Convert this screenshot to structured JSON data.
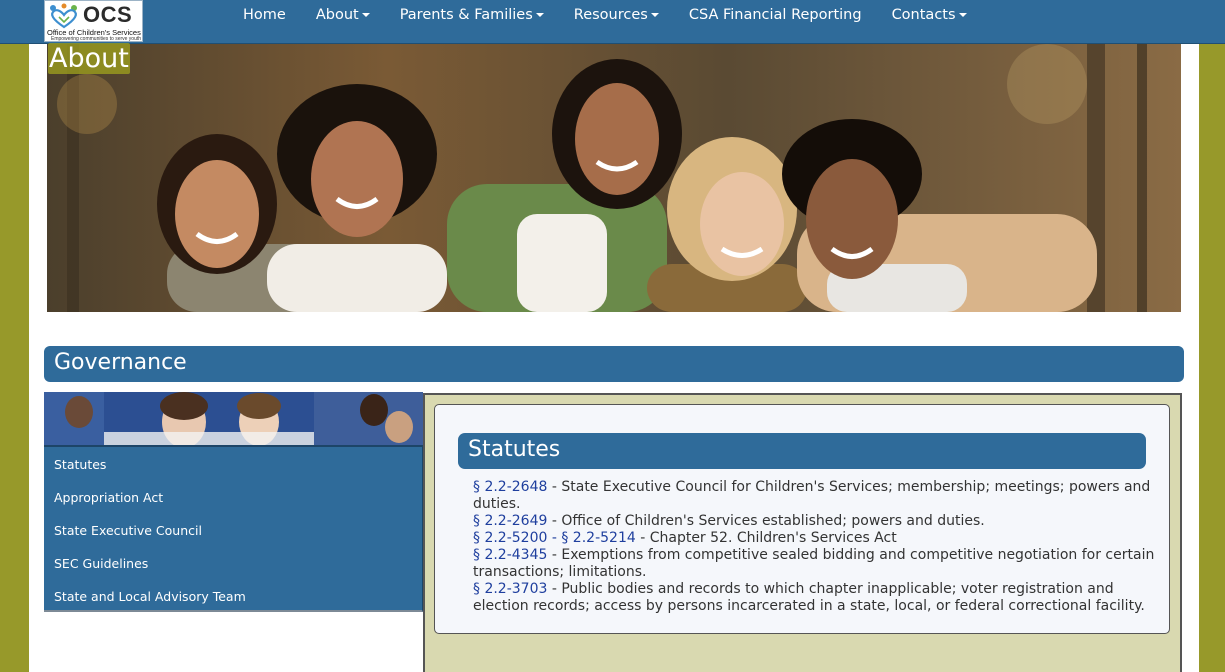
{
  "logo": {
    "text": "OCS",
    "org_name": "Office of Children's Services",
    "tagline": "Empowering communities to serve youth"
  },
  "nav": [
    {
      "label": "Home",
      "dropdown": false
    },
    {
      "label": "About",
      "dropdown": true
    },
    {
      "label": "Parents & Families",
      "dropdown": true
    },
    {
      "label": "Resources",
      "dropdown": true
    },
    {
      "label": "CSA Financial Reporting",
      "dropdown": false
    },
    {
      "label": "Contacts",
      "dropdown": true
    }
  ],
  "hero": {
    "title": "About"
  },
  "governance": {
    "title": "Governance"
  },
  "sidebar": {
    "items": [
      {
        "label": "Statutes"
      },
      {
        "label": "Appropriation Act"
      },
      {
        "label": "State Executive Council"
      },
      {
        "label": "SEC Guidelines"
      },
      {
        "label": "State and Local Advisory Team"
      }
    ]
  },
  "statutes": {
    "title": "Statutes",
    "entries": [
      {
        "link": "§ 2.2-2648",
        "text": " - State Executive Council for Children's Services; membership; meetings; powers and duties."
      },
      {
        "link": "§ 2.2-2649",
        "text": " - Office of Children's Services established; powers and duties."
      },
      {
        "link": "§ 2.2-5200",
        "sep": " - ",
        "link2": "§ 2.2-5214",
        "text": " - Chapter 52. Children's Services Act"
      },
      {
        "link": "§ 2.2-4345",
        "text": " - Exemptions from competitive sealed bidding and competitive negotiation for certain transactions; limitations."
      },
      {
        "link": "§ 2.2-3703",
        "text": " - Public bodies and records to which chapter inapplicable; voter registration and election records; access by persons incarcerated in a state, local, or federal correctional facility."
      }
    ]
  },
  "colors": {
    "page_background": "#97992a",
    "brand_blue": "#2f6b9a",
    "panel_tan": "#d9d9b0",
    "link_blue": "#1f3f9e"
  }
}
